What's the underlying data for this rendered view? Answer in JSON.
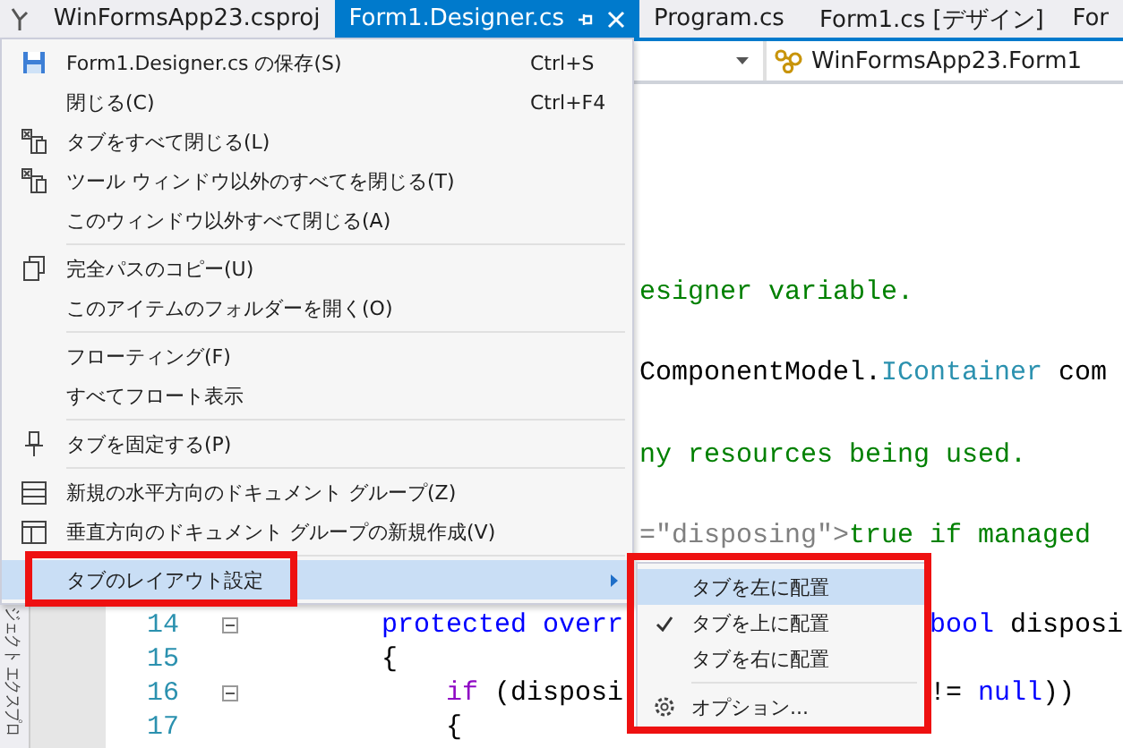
{
  "tabs": [
    {
      "label": "WinFormsApp23.csproj",
      "selected": false
    },
    {
      "label": "Form1.Designer.cs",
      "selected": true
    },
    {
      "label": "Program.cs",
      "selected": false
    },
    {
      "label": "Form1.cs [デザイン]",
      "selected": false
    },
    {
      "label": "For",
      "selected": false
    }
  ],
  "navigation_bar": {
    "class_selector": "WinFormsApp23.Form1"
  },
  "code_upper": [
    {
      "tokens": [
        {
          "text": "esigner variable.",
          "kind": "comment"
        }
      ]
    },
    {
      "tokens": [
        {
          "text": "ComponentModel.",
          "kind": "plain"
        },
        {
          "text": "IContainer",
          "kind": "type"
        },
        {
          "text": " com",
          "kind": "plain"
        }
      ]
    },
    {
      "tokens": [
        {
          "text": "ny resources being used.",
          "kind": "comment"
        }
      ]
    },
    {
      "tokens": [
        {
          "text": "=\"disposing\">",
          "kind": "doc"
        },
        {
          "text": "true if managed",
          "kind": "comment"
        }
      ]
    }
  ],
  "code_lower": [
    {
      "number": "14",
      "fold": true,
      "left": [
        {
          "text": "protected overr",
          "kind": "keyword"
        }
      ],
      "right": [
        {
          "text": "bool",
          "kind": "keyword"
        },
        {
          "text": " disposi",
          "kind": "plain"
        }
      ]
    },
    {
      "number": "15",
      "fold": false,
      "left": [
        {
          "text": "{",
          "kind": "plain"
        }
      ]
    },
    {
      "number": "16",
      "fold": true,
      "left": [
        {
          "text": "    if",
          "kind": "control"
        },
        {
          "text": " (disposi",
          "kind": "plain"
        }
      ],
      "right": [
        {
          "text": "!= ",
          "kind": "plain"
        },
        {
          "text": "null",
          "kind": "keyword"
        },
        {
          "text": "))",
          "kind": "plain"
        }
      ]
    },
    {
      "number": "17",
      "fold": false,
      "left": [
        {
          "text": "    {",
          "kind": "plain"
        }
      ]
    }
  ],
  "side_panel": {
    "label": "ジェクト エクスプロ"
  },
  "context_menu": {
    "groups": [
      [
        {
          "label": "Form1.Designer.cs の保存(S)",
          "shortcut": "Ctrl+S",
          "kind": "save",
          "highlighted": false
        },
        {
          "label": "閉じる(C)",
          "shortcut": "Ctrl+F4",
          "kind": "none",
          "highlighted": false
        },
        {
          "label": "タブをすべて閉じる(L)",
          "kind": "closeall",
          "highlighted": false
        },
        {
          "label": "ツール ウィンドウ以外のすべてを閉じる(T)",
          "kind": "closeall",
          "highlighted": false
        },
        {
          "label": "このウィンドウ以外すべて閉じる(A)",
          "kind": "none",
          "highlighted": false
        }
      ],
      [
        {
          "label": "完全パスのコピー(U)",
          "kind": "copy",
          "highlighted": false
        },
        {
          "label": "このアイテムのフォルダーを開く(O)",
          "kind": "none",
          "highlighted": false
        }
      ],
      [
        {
          "label": "フローティング(F)",
          "kind": "none",
          "highlighted": false
        },
        {
          "label": "すべてフロート表示",
          "kind": "none",
          "highlighted": false
        }
      ],
      [
        {
          "label": "タブを固定する(P)",
          "kind": "pin",
          "highlighted": false
        }
      ],
      [
        {
          "label": "新規の水平方向のドキュメント グループ(Z)",
          "kind": "hsplit",
          "highlighted": false
        },
        {
          "label": "垂直方向のドキュメント グループの新規作成(V)",
          "kind": "vsplit",
          "highlighted": false
        }
      ],
      [
        {
          "label": "タブのレイアウト設定",
          "kind": "none",
          "highlighted": true,
          "submenu": true,
          "annotated": true
        }
      ]
    ]
  },
  "submenu": {
    "annotated": true,
    "groups": [
      [
        {
          "label": "タブを左に配置",
          "kind": "none",
          "checked": false,
          "highlighted": true
        },
        {
          "label": "タブを上に配置",
          "kind": "none",
          "checked": true,
          "highlighted": false
        },
        {
          "label": "タブを右に配置",
          "kind": "none",
          "checked": false,
          "highlighted": false
        }
      ],
      [
        {
          "label": "オプション...",
          "kind": "gear",
          "checked": false,
          "highlighted": false
        }
      ]
    ]
  }
}
